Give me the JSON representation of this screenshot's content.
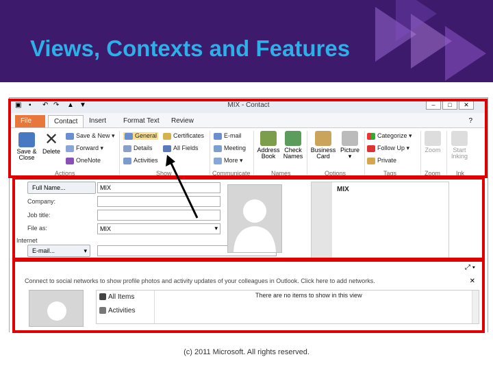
{
  "slide_title": "Views, Contexts and Features",
  "footer": "(c) 2011 Microsoft. All rights reserved.",
  "window": {
    "title": "MIX - Contact"
  },
  "tabs": [
    "File",
    "Contact",
    "Insert",
    "Format Text",
    "Review"
  ],
  "ribbon": {
    "save_close": [
      "Save &",
      "Close"
    ],
    "delete": "Delete",
    "save_new": "Save & New",
    "forward": "Forward",
    "onenote": "OneNote",
    "actions_group": "Actions",
    "general": "General",
    "details": "Details",
    "activities": "Activities",
    "certificates": "Certificates",
    "all_fields": "All Fields",
    "show_group": "Show",
    "email": "E-mail",
    "meeting": "Meeting",
    "more": "More",
    "communicate_group": "Communicate",
    "address_book": [
      "Address",
      "Book"
    ],
    "check_names": [
      "Check",
      "Names"
    ],
    "names_group": "Names",
    "business_card": [
      "Business",
      "Card"
    ],
    "picture": "Picture",
    "options_group": "Options",
    "categorize": "Categorize",
    "follow_up": "Follow Up",
    "private": "Private",
    "tags_group": "Tags",
    "zoom": "Zoom",
    "zoom_group": "Zoom",
    "start_inking": [
      "Start",
      "Inking"
    ],
    "ink_group": "Ink"
  },
  "form": {
    "full_name_button": "Full Name...",
    "full_name_value": "MIX",
    "company_label": "Company:",
    "job_title_label": "Job title:",
    "file_as_label": "File as:",
    "file_as_value": "MIX",
    "internet_label": "Internet",
    "email_button": "E-mail...",
    "card_name": "MIX"
  },
  "people_pane": {
    "social_text": "Connect to social networks to show profile photos and activity updates of your colleagues in Outlook. Click here to add networks.",
    "all_items": "All Items",
    "activities": "Activities",
    "empty_text": "There are no items to show in this view"
  },
  "colors": {
    "banner": "#3d1a6b",
    "title": "#2bb0e8",
    "highlight_box": "#e00000",
    "file_tab": "#e8773c"
  }
}
